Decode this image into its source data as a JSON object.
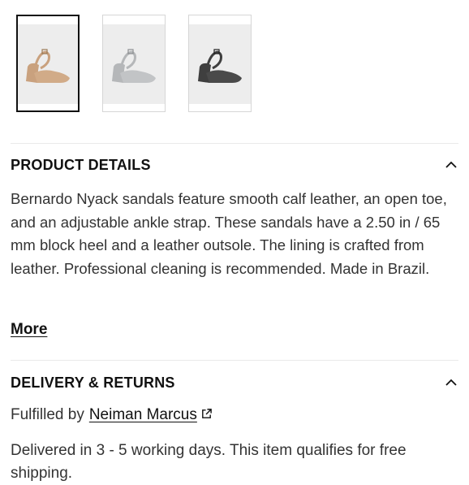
{
  "gallery": {
    "thumbnails": [
      {
        "alt": "tan sandal",
        "color": "#c9a17e",
        "selected": true
      },
      {
        "alt": "light gray sandal",
        "color": "#b5b7b9",
        "selected": false
      },
      {
        "alt": "dark gray sandal",
        "color": "#4a4a4a",
        "selected": false
      }
    ]
  },
  "product_details": {
    "title": "PRODUCT DETAILS",
    "description": "Bernardo Nyack sandals feature smooth calf leather, an open toe, and an adjustable ankle strap. These sandals have a 2.50 in / 65 mm block heel and a leather outsole. The lining is crafted from leather. Professional cleaning is recommended. Made in Brazil.",
    "more_label": "More"
  },
  "delivery": {
    "title": "DELIVERY & RETURNS",
    "fulfilled_prefix": "Fulfilled by",
    "fulfilled_link": "Neiman Marcus",
    "delivered_text": "Delivered in 3 - 5 working days. This item qualifies for free shipping."
  },
  "icons": {
    "collapse": "chevron-up-icon",
    "external": "external-link-icon"
  }
}
